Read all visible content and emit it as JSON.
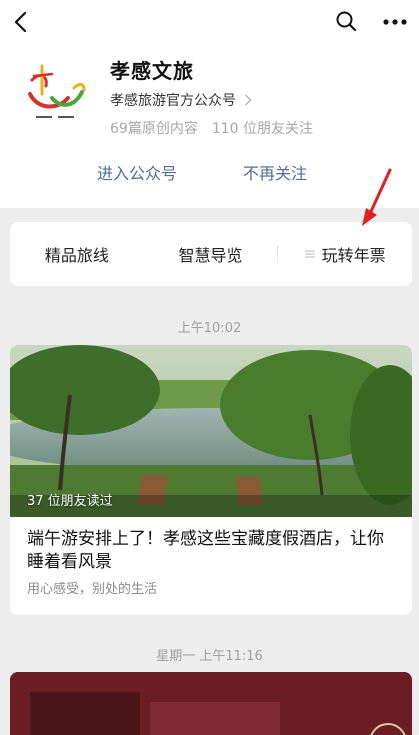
{
  "nav": {
    "back_icon": "back-chevron-icon",
    "search_icon": "search-icon",
    "more_icon": "more-dots-icon"
  },
  "account": {
    "name": "孝感文旅",
    "subtitle": "孝感旅游官方公众号",
    "original_count": "69篇原创内容",
    "friends_following": "110 位朋友关注",
    "logo_icon": "xiaogan-tourism-logo"
  },
  "actions": {
    "enter": "进入公众号",
    "unfollow": "不再关注"
  },
  "menu": {
    "items": [
      {
        "label": "精品旅线"
      },
      {
        "label": "智慧导览"
      },
      {
        "label": "玩转年票"
      }
    ]
  },
  "feed": [
    {
      "time": "上午10:02",
      "read_count": "37 位朋友读过",
      "title": "端午游安排上了！孝感这些宝藏度假酒店，让你睡着看风景",
      "digest": "用心感受，别处的生活"
    },
    {
      "time": "星期一 上午11:16"
    }
  ],
  "colors": {
    "link": "#576b95",
    "annotation_arrow": "#e02020",
    "background": "#ededed"
  }
}
